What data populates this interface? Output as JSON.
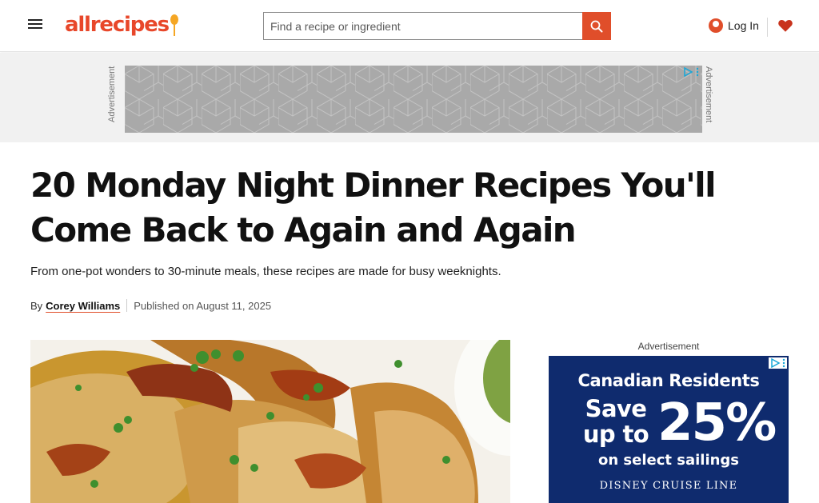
{
  "header": {
    "menu_icon": "hamburger-menu-icon",
    "logo_text": "allrecipes",
    "search": {
      "placeholder": "Find a recipe or ingredient",
      "value": ""
    },
    "search_icon": "search-icon",
    "login_label": "Log In",
    "login_icon": "user-avatar-icon",
    "saved_icon": "heart-icon"
  },
  "top_ad": {
    "label_left": "Advertisement",
    "label_right": "Advertisement",
    "badge_icons": [
      "adchoices-play-icon",
      "more-vertical-icon"
    ]
  },
  "article": {
    "title": "20 Monday Night Dinner Recipes You'll Come Back to Again and Again",
    "dek": "From one-pot wonders to 30-minute meals, these recipes are made for busy weeknights.",
    "byline_prefix": "By",
    "author": "Corey Williams",
    "published": "Published on August 11, 2025"
  },
  "side_ad": {
    "label": "Advertisement",
    "line1": "Canadian Residents",
    "save_text": "Save up to",
    "percent": "25%",
    "line3": "on select sailings",
    "brand": "DISNEY CRUISE LINE"
  },
  "colors": {
    "brand": "#e8472a",
    "search_button": "#e04e2a",
    "ad_placeholder": "#a9a9a9",
    "side_ad_background": "#0f2b6e"
  }
}
